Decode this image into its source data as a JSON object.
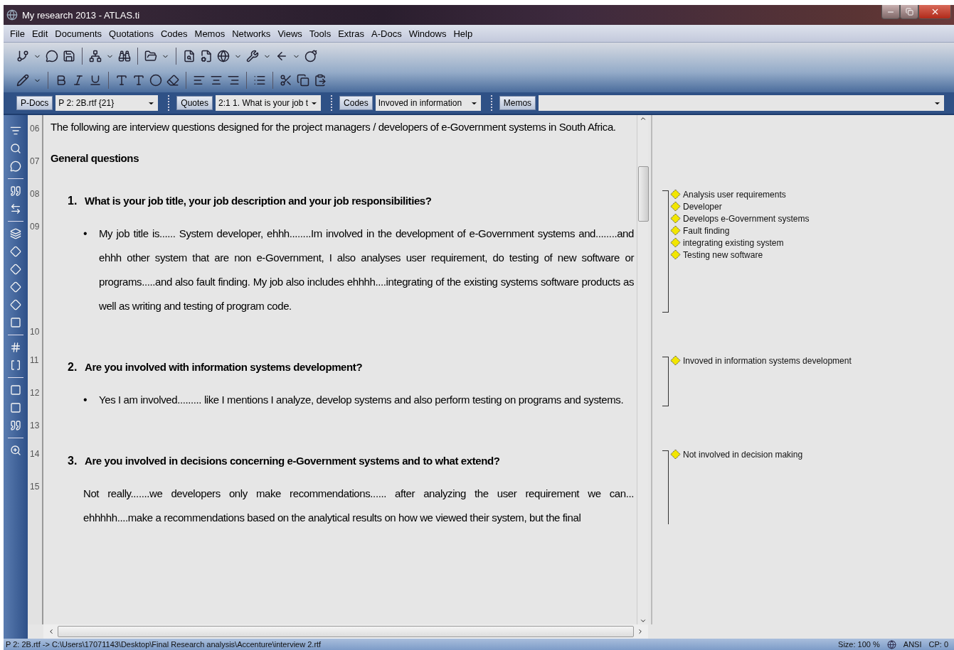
{
  "window": {
    "title": "My research 2013 - ATLAS.ti"
  },
  "menu": [
    "File",
    "Edit",
    "Documents",
    "Quotations",
    "Codes",
    "Memos",
    "Networks",
    "Views",
    "Tools",
    "Extras",
    "A-Docs",
    "Windows",
    "Help"
  ],
  "selectors": [
    {
      "button": "P-Docs",
      "value": "P 2: 2B.rtf {21}"
    },
    {
      "button": "Quotes",
      "value": "2:1 1. What is your job t"
    },
    {
      "button": "Codes",
      "value": "Invoved in information"
    },
    {
      "button": "Memos"
    }
  ],
  "document": {
    "segments": [
      {
        "rows": [
          {
            "line": "06",
            "kind": "paragraph",
            "text": "The following are interview questions designed for the project managers / developers of e-Government systems in South Africa."
          },
          {
            "line": "07",
            "kind": "heading",
            "text": "General questions"
          }
        ]
      },
      {
        "rows": [
          {
            "line": "08",
            "kind": "question",
            "number": "1.",
            "text": "What is your job title, your job description and your job responsibilities?"
          },
          {
            "line": "09",
            "kind": "bullet",
            "marker": "•",
            "text": "My job title is...... System developer, ehhh........Im involved in the development of e-Government systems and........and ehhh other system that are non e-Government, I also analyses user requirement, do testing of new software or programs.....and also fault finding. My job also includes ehhhh....integrating of the existing systems software products as well as writing and testing of program code."
          }
        ],
        "codes": [
          "Analysis user requirements",
          "Developer",
          "Develops e-Government systems",
          "Fault finding",
          "integrating existing system",
          "Testing new software"
        ]
      },
      {
        "rows": [
          {
            "line": "10",
            "kind": "empty",
            "text": ""
          }
        ]
      },
      {
        "rows": [
          {
            "line": "11",
            "kind": "question",
            "number": "2.",
            "text": "Are you involved with information systems development?"
          },
          {
            "line": "12",
            "kind": "bullet",
            "marker": "•",
            "text": "Yes I am involved......... like I mentions I analyze, develop systems and also perform testing on programs and systems."
          }
        ],
        "codes": [
          "Invoved in information systems development"
        ]
      },
      {
        "rows": [
          {
            "line": "13",
            "kind": "empty",
            "text": ""
          }
        ]
      },
      {
        "rows": [
          {
            "line": "14",
            "kind": "question",
            "number": "3.",
            "text": "Are you involved in decisions concerning e-Government systems and to what extend?"
          },
          {
            "line": "15",
            "kind": "indented",
            "text": "Not really.......we developers only make recommendations...... after analyzing the user requirement we can... ehhhhh....make a recommendations based on the analytical results on how we viewed their system, but the final"
          }
        ],
        "codes": [
          "Not involved in decision making"
        ]
      }
    ]
  },
  "status_bar": {
    "path": "P 2: 2B.rtf -> C:\\Users\\17071143\\Desktop\\Final Research analysis\\Accenture\\interview 2.rtf",
    "size": "Size: 100 %",
    "encoding": "ANSI",
    "cp": "CP: 0"
  }
}
